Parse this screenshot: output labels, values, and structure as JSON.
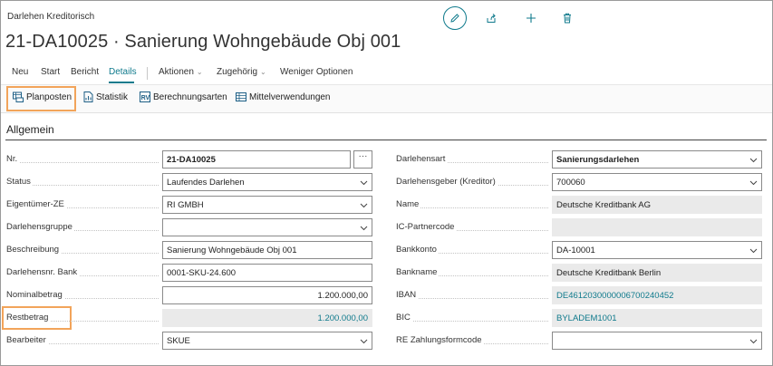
{
  "page": {
    "breadcrumb": "Darlehen Kreditorisch",
    "title": "21-DA10025 · Sanierung Wohngebäude Obj 001",
    "accent_color": "#0f7a8c",
    "highlight_color": "#f2a45a"
  },
  "top_actions": {
    "icons": [
      "edit-icon",
      "share-icon",
      "add-icon",
      "delete-icon"
    ]
  },
  "menu": {
    "items": [
      "Neu",
      "Start",
      "Bericht",
      "Details"
    ],
    "active": "Details",
    "aktionen": "Aktionen",
    "zugehoerig": "Zugehörig",
    "weniger": "Weniger Optionen"
  },
  "actions": {
    "planposten": "Planposten",
    "statistik": "Statistik",
    "berechnungsarten": "Berechnungsarten",
    "mittelverwendungen": "Mittelverwendungen"
  },
  "section": {
    "title": "Allgemein"
  },
  "left_fields": [
    {
      "label": "Nr.",
      "value": "21-DA10025"
    },
    {
      "label": "Status",
      "value": "Laufendes Darlehen"
    },
    {
      "label": "Eigentümer-ZE",
      "value": "RI GMBH"
    },
    {
      "label": "Darlehensgruppe",
      "value": ""
    },
    {
      "label": "Beschreibung",
      "value": "Sanierung Wohngebäude Obj 001"
    },
    {
      "label": "Darlehensnr. Bank",
      "value": "0001-SKU-24.600"
    },
    {
      "label": "Nominalbetrag",
      "value": "1.200.000,00"
    },
    {
      "label": "Restbetrag",
      "value": "1.200.000,00"
    },
    {
      "label": "Bearbeiter",
      "value": "SKUE"
    }
  ],
  "right_fields": [
    {
      "label": "Darlehensart",
      "value": "Sanierungsdarlehen"
    },
    {
      "label": "Darlehensgeber (Kreditor)",
      "value": "700060"
    },
    {
      "label": "Name",
      "value": "Deutsche Kreditbank AG"
    },
    {
      "label": "IC-Partnercode",
      "value": ""
    },
    {
      "label": "Bankkonto",
      "value": "DA-10001"
    },
    {
      "label": "Bankname",
      "value": "Deutsche Kreditbank Berlin"
    },
    {
      "label": "IBAN",
      "value": "DE46120300000067002404​52"
    },
    {
      "label": "BIC",
      "value": "BYLADEM1001"
    },
    {
      "label": "RE Zahlungsformcode",
      "value": ""
    }
  ],
  "assist_button": "···"
}
